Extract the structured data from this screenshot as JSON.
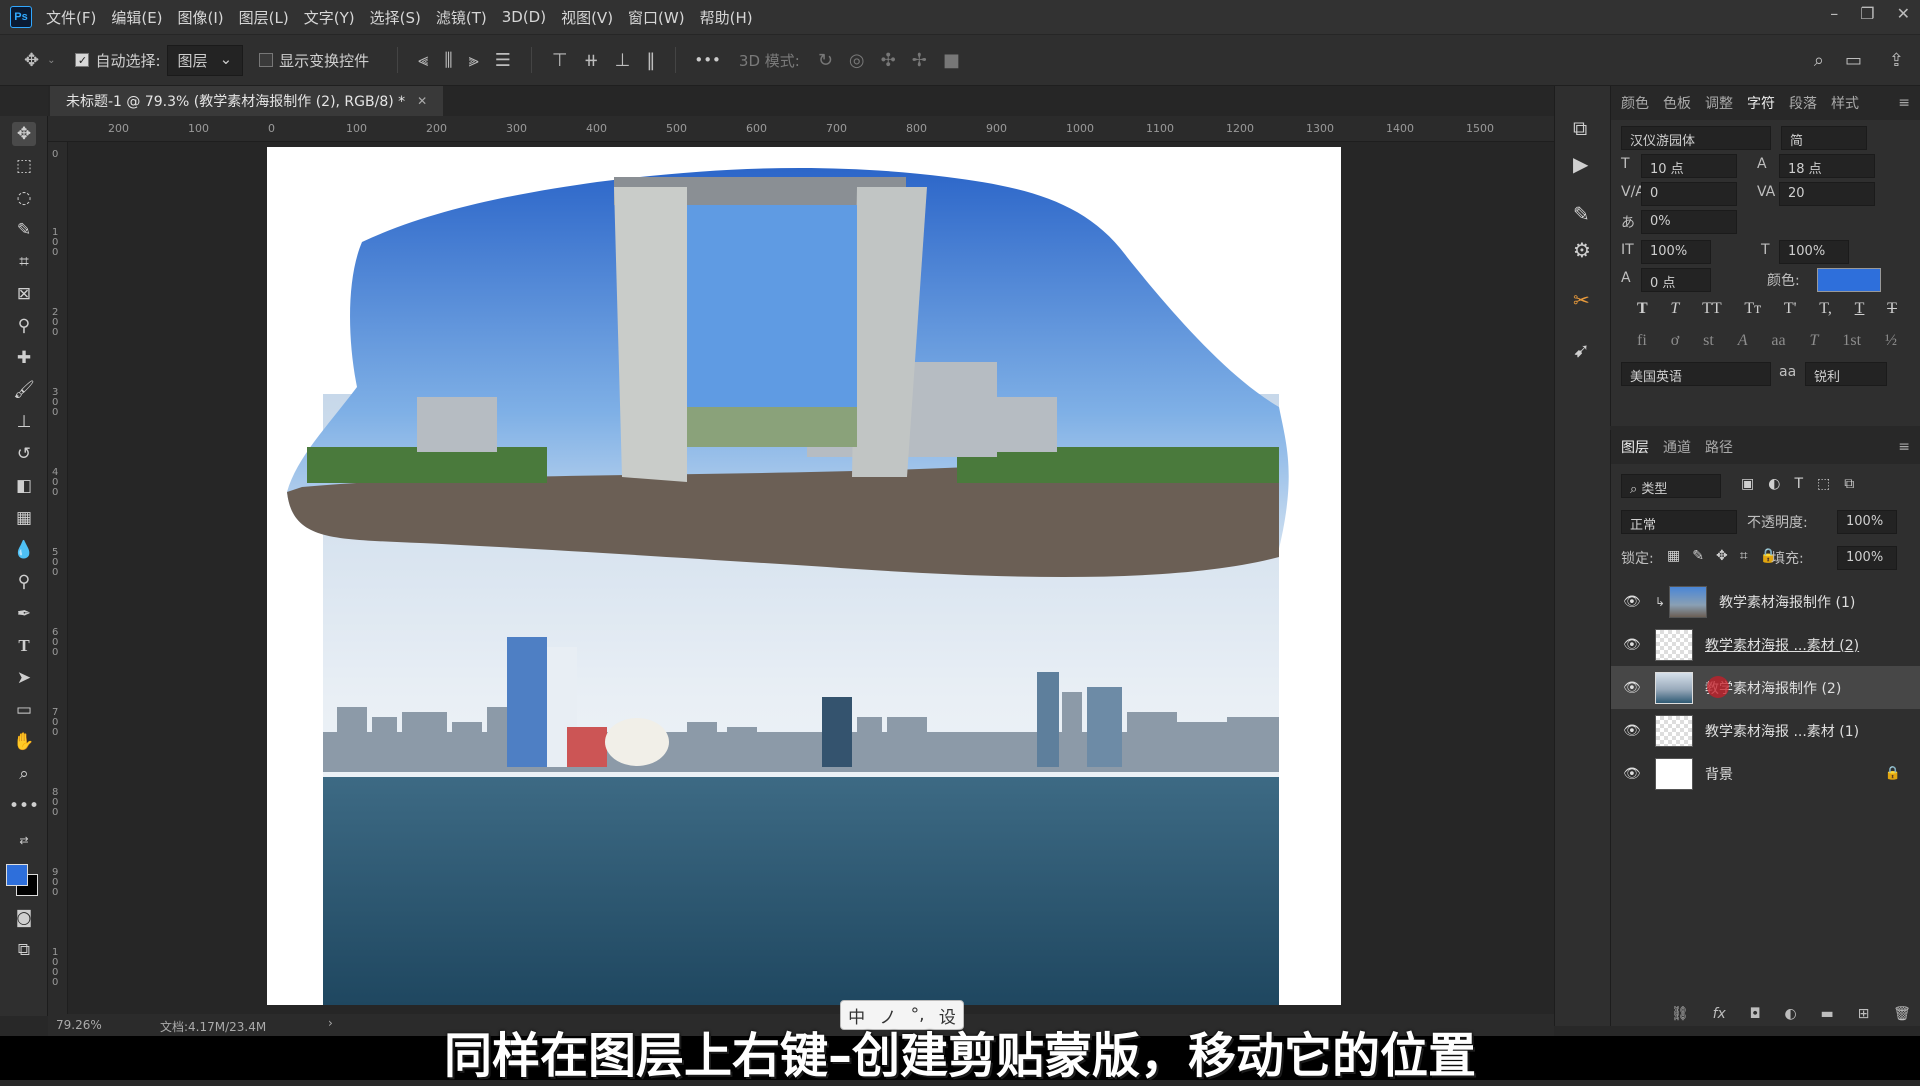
{
  "app": {
    "logo": "Ps",
    "window_controls": [
      "–",
      "❐",
      "✕"
    ]
  },
  "menu": [
    "文件(F)",
    "编辑(E)",
    "图像(I)",
    "图层(L)",
    "文字(Y)",
    "选择(S)",
    "滤镜(T)",
    "3D(D)",
    "视图(V)",
    "窗口(W)",
    "帮助(H)"
  ],
  "options": {
    "auto_select_label": "自动选择:",
    "auto_select_target": "图层",
    "show_transform_label": "显示变换控件",
    "mode_3d_label": "3D 模式:",
    "more": "•••"
  },
  "document": {
    "tab_title": "未标题-1 @ 79.3% (教学素材海报制作 (2), RGB/8) *",
    "close": "✕"
  },
  "rulers": {
    "h": [
      "200",
      "100",
      "0",
      "100",
      "200",
      "300",
      "400",
      "500",
      "600",
      "700",
      "800",
      "900",
      "1000",
      "1100",
      "1200",
      "1300",
      "1400",
      "1500"
    ],
    "v": [
      "0",
      "1\n0\n0",
      "2\n0\n0",
      "3\n0\n0",
      "4\n0\n0",
      "5\n0\n0",
      "6\n0\n0",
      "7\n0\n0",
      "8\n0\n0",
      "9\n0\n0",
      "1\n0\n0\n0"
    ]
  },
  "status": {
    "zoom": "79.26%",
    "doc": "文档:4.17M/23.4M",
    "arrow": "›"
  },
  "character_panel": {
    "tabs": [
      "颜色",
      "色板",
      "调整",
      "字符",
      "段落",
      "样式"
    ],
    "active_tab": "字符",
    "font_family": "汉仪游园体",
    "font_style": "简",
    "size": "10 点",
    "leading": "18 点",
    "kerning": "0",
    "tracking": "20",
    "scale_percent": "0%",
    "vscale": "100%",
    "hscale": "100%",
    "baseline": "0 点",
    "color_label": "颜色:",
    "color_value": "#2e6fdb",
    "language": "美国英语",
    "aa_label": "aa",
    "antialias": "锐利",
    "style_row1": [
      "T",
      "T",
      "TT",
      "Tт",
      "T'",
      "T,",
      "T",
      "T"
    ],
    "style_row2": [
      "fi",
      "ơ",
      "st",
      "A",
      "aa",
      "T",
      "1st",
      "½"
    ]
  },
  "layers_panel": {
    "tabs": [
      "图层",
      "通道",
      "路径"
    ],
    "active_tab": "图层",
    "filter_label": "类型",
    "blend_mode": "正常",
    "opacity_label": "不透明度:",
    "opacity": "100%",
    "lock_label": "锁定:",
    "fill_label": "填充:",
    "fill": "100%",
    "layers": [
      {
        "name": "教学素材海报制作 (1)",
        "clipped": true
      },
      {
        "name": "教学素材海报 ...素材 (2)",
        "clipped": false
      },
      {
        "name": "教学素材海报制作 (2)",
        "clipped": false,
        "selected": true
      },
      {
        "name": "教学素材海报 ...素材 (1)",
        "clipped": false
      },
      {
        "name": "背景",
        "clipped": false,
        "locked": true
      }
    ],
    "footer_icons": [
      "link-icon",
      "fx-icon",
      "mask-icon",
      "adjustment-icon",
      "folder-icon",
      "new-layer-icon",
      "trash-icon"
    ]
  },
  "ime": {
    "items": [
      "中",
      "ノ",
      "°,",
      "设"
    ]
  },
  "subtitle": "同样在图层上右键–创建剪贴蒙版，移动它的位置"
}
